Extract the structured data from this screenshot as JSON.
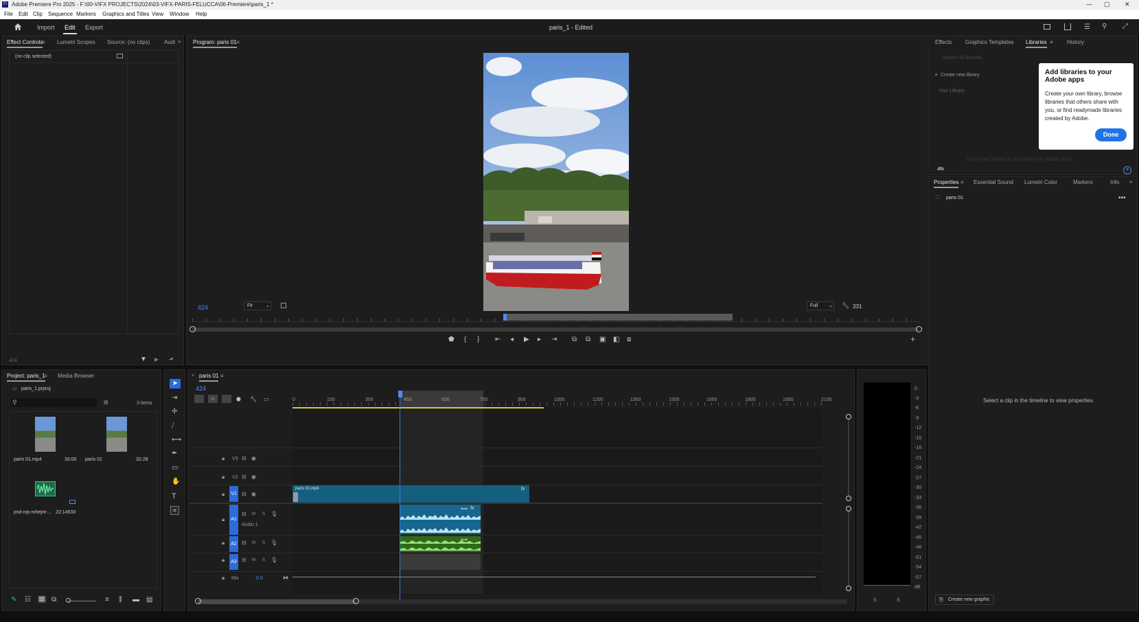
{
  "window": {
    "title": "Adobe Premiere Pro 2025 - F:\\00-VIFX PROJECTS\\2024\\03-VIFX-PARIS-FELUCCA\\06-Premiere\\paris_1 *",
    "min": "—",
    "max": "▢",
    "close": "✕"
  },
  "menubar": [
    "File",
    "Edit",
    "Clip",
    "Sequence",
    "Markers",
    "Graphics and Titles",
    "View",
    "Window",
    "Help"
  ],
  "header": {
    "workspaces": [
      "Import",
      "Edit",
      "Export"
    ],
    "active": "Edit",
    "doc_title": "paris_1 - Edited"
  },
  "effect_controls": {
    "tabs": [
      "Effect Controls",
      "Lumetri Scopes",
      "Source: (no clips)",
      "Audi"
    ],
    "no_clip": "(no clip selected)",
    "timecode": "424"
  },
  "program": {
    "tab": "Program: paris 01",
    "timecode": "424",
    "fit": "Fit",
    "quality": "Full",
    "end_timecode": "331"
  },
  "libraries": {
    "tabs": [
      "Effects",
      "Graphics Templates",
      "Libraries",
      "History"
    ],
    "search_placeholder": "Search all libraries",
    "create": "Create new library",
    "your_library": "Your Library",
    "faded_hint": "Inspire and speed up your work with Adobe Stock",
    "popup": {
      "title": "Add libraries to your Adobe apps",
      "body": "Create your own library, browse libraries that others share with you, or find readymade libraries created by Adobe.",
      "done": "Done"
    }
  },
  "properties": {
    "tabs": [
      "Properties",
      "Essential Sound",
      "Lumetri Color",
      "Markers",
      "Info"
    ],
    "clip": "paris 01",
    "hint": "Select a clip in the timeline to view properties.",
    "create_graphic": "Create new graphic"
  },
  "project": {
    "tabs": [
      "Project: paris_1",
      "Media Browser"
    ],
    "file": "paris_1.prproj",
    "items_count": "3 items",
    "items": [
      {
        "name": "paris 01.mp4",
        "duration": "33:00"
      },
      {
        "name": "paris 01",
        "duration": "32:28"
      },
      {
        "name": "jmd-rqs-mhejnt-...",
        "duration": "22:14533"
      }
    ]
  },
  "timeline": {
    "tab": "paris 01",
    "timecode": "424",
    "ruler": [
      "0",
      "150",
      "300",
      "450",
      "600",
      "750",
      "900",
      "1050",
      "1200",
      "1350",
      "1500",
      "1650",
      "1800",
      "1950",
      "2100"
    ],
    "tracks": [
      {
        "id": "V3",
        "label": "V3"
      },
      {
        "id": "V2",
        "label": "V2"
      },
      {
        "id": "V1",
        "label": "V1"
      },
      {
        "id": "A1",
        "label": "A1",
        "name": "Audio 1"
      },
      {
        "id": "A2",
        "label": "A2"
      },
      {
        "id": "A3",
        "label": "A3"
      }
    ],
    "mix_label": "Mix",
    "mix_value": "0.0",
    "clip_name": "paris 01.mp4",
    "fx": "fx",
    "m": "M",
    "s": "S"
  },
  "meter": {
    "scale": [
      "0",
      "-3",
      "-6",
      "-9",
      "-12",
      "-15",
      "-18",
      "-21",
      "-24",
      "-27",
      "-30",
      "-33",
      "-36",
      "-39",
      "-42",
      "-45",
      "-48",
      "-51",
      "-54",
      "-57",
      "dB"
    ],
    "solo": [
      "S",
      "S"
    ]
  }
}
